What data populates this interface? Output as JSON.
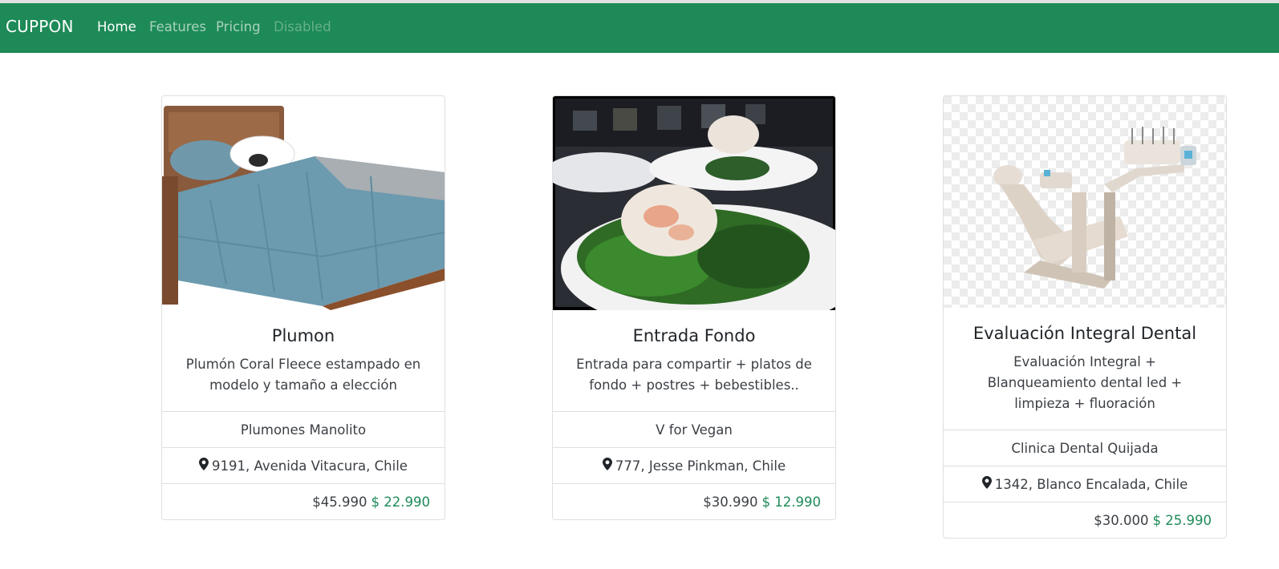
{
  "nav": {
    "brand": "CUPPON",
    "links": [
      {
        "label": "Home",
        "state": "active"
      },
      {
        "label": "Features",
        "state": "normal"
      },
      {
        "label": "Pricing",
        "state": "normal"
      },
      {
        "label": "Disabled",
        "state": "disabled"
      }
    ]
  },
  "colors": {
    "accent": "#1d8a57"
  },
  "cards": [
    {
      "title": "Plumon",
      "description": "Plumón Coral Fleece estampado en modelo y tamaño a elección",
      "company": "Plumones Manolito",
      "address": "9191, Avenida Vitacura, Chile",
      "price_old": "$45.990",
      "price_new": "$ 22.990",
      "image_icon": "bed-comforter-photo"
    },
    {
      "title": "Entrada Fondo",
      "description": "Entrada para compartir + platos de fondo + postres + bebestibles..",
      "company": "V for Vegan",
      "address": "777, Jesse Pinkman, Chile",
      "price_old": "$30.990",
      "price_new": "$ 12.990",
      "image_icon": "salad-dish-photo"
    },
    {
      "title": "Evaluación Integral Dental",
      "description": "Evaluación Integral + Blanqueamiento dental led + limpieza + fluoración",
      "company": "Clinica Dental Quijada",
      "address": "1342, Blanco Encalada, Chile",
      "price_old": "$30.000",
      "price_new": "$ 25.990",
      "image_icon": "dental-chair-photo"
    }
  ]
}
